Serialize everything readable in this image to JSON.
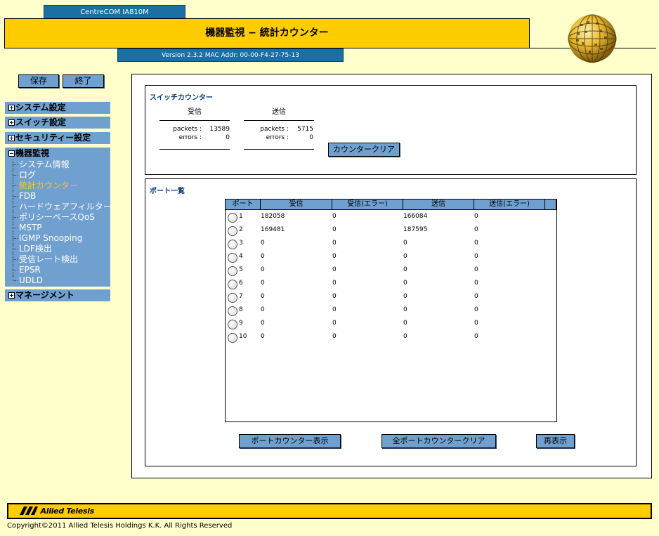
{
  "header": {
    "model": "CentreCOM IA810M",
    "title": "機器監視 − 統計カウンター",
    "version": "Version 2.3.2 MAC Addr: 00-00-F4-27-75-13"
  },
  "buttons": {
    "save": "保存",
    "exit": "終了",
    "counter_clear": "カウンタークリア",
    "port_counter_show": "ポートカウンター表示",
    "all_port_counter_clear": "全ポートカウンタークリア",
    "refresh": "再表示"
  },
  "sidebar": {
    "categories": [
      {
        "label": "システム設定",
        "box": "+"
      },
      {
        "label": "スイッチ設定",
        "box": "+"
      },
      {
        "label": "セキュリティー設定",
        "box": "+"
      },
      {
        "label": "機器監視",
        "box": "−"
      },
      {
        "label": "マネージメント",
        "box": "+"
      }
    ],
    "monitor_items": [
      "システム情報",
      "ログ",
      "統計カウンター",
      "FDB",
      "ハードウェアフィルター",
      "ポリシーベースQoS",
      "MSTP",
      "IGMP Snooping",
      "LDF検出",
      "受信レート検出",
      "EPSR",
      "UDLD"
    ]
  },
  "switch_counter": {
    "title": "スイッチカウンター",
    "rx_head": "受信",
    "tx_head": "送信",
    "packets_label": "packets :",
    "errors_label": "errors :",
    "rx_packets": "13589",
    "rx_errors": "0",
    "tx_packets": "5715",
    "tx_errors": "0"
  },
  "port_list": {
    "title": "ポート一覧",
    "headers": [
      "ポート",
      "受信",
      "受信(エラー)",
      "送信",
      "送信(エラー)"
    ],
    "rows": [
      {
        "port": "1",
        "rx": "182058",
        "rx_err": "0",
        "tx": "166084",
        "tx_err": "0"
      },
      {
        "port": "2",
        "rx": "169481",
        "rx_err": "0",
        "tx": "187595",
        "tx_err": "0"
      },
      {
        "port": "3",
        "rx": "0",
        "rx_err": "0",
        "tx": "0",
        "tx_err": "0"
      },
      {
        "port": "4",
        "rx": "0",
        "rx_err": "0",
        "tx": "0",
        "tx_err": "0"
      },
      {
        "port": "5",
        "rx": "0",
        "rx_err": "0",
        "tx": "0",
        "tx_err": "0"
      },
      {
        "port": "6",
        "rx": "0",
        "rx_err": "0",
        "tx": "0",
        "tx_err": "0"
      },
      {
        "port": "7",
        "rx": "0",
        "rx_err": "0",
        "tx": "0",
        "tx_err": "0"
      },
      {
        "port": "8",
        "rx": "0",
        "rx_err": "0",
        "tx": "0",
        "tx_err": "0"
      },
      {
        "port": "9",
        "rx": "0",
        "rx_err": "0",
        "tx": "0",
        "tx_err": "0"
      },
      {
        "port": "10",
        "rx": "0",
        "rx_err": "0",
        "tx": "0",
        "tx_err": "0"
      }
    ]
  },
  "footer": {
    "logo": "Allied Telesis",
    "copyright": "Copyright©2011 Allied Telesis Holdings K.K. All Rights Reserved"
  },
  "colors": {
    "background": "#ffffcc",
    "header_yellow": "#ffcc00",
    "header_blue": "#1a6fa3",
    "menu_blue": "#6fa0d0",
    "active_item": "#ffcc00",
    "section_title": "#0a3c7d"
  }
}
